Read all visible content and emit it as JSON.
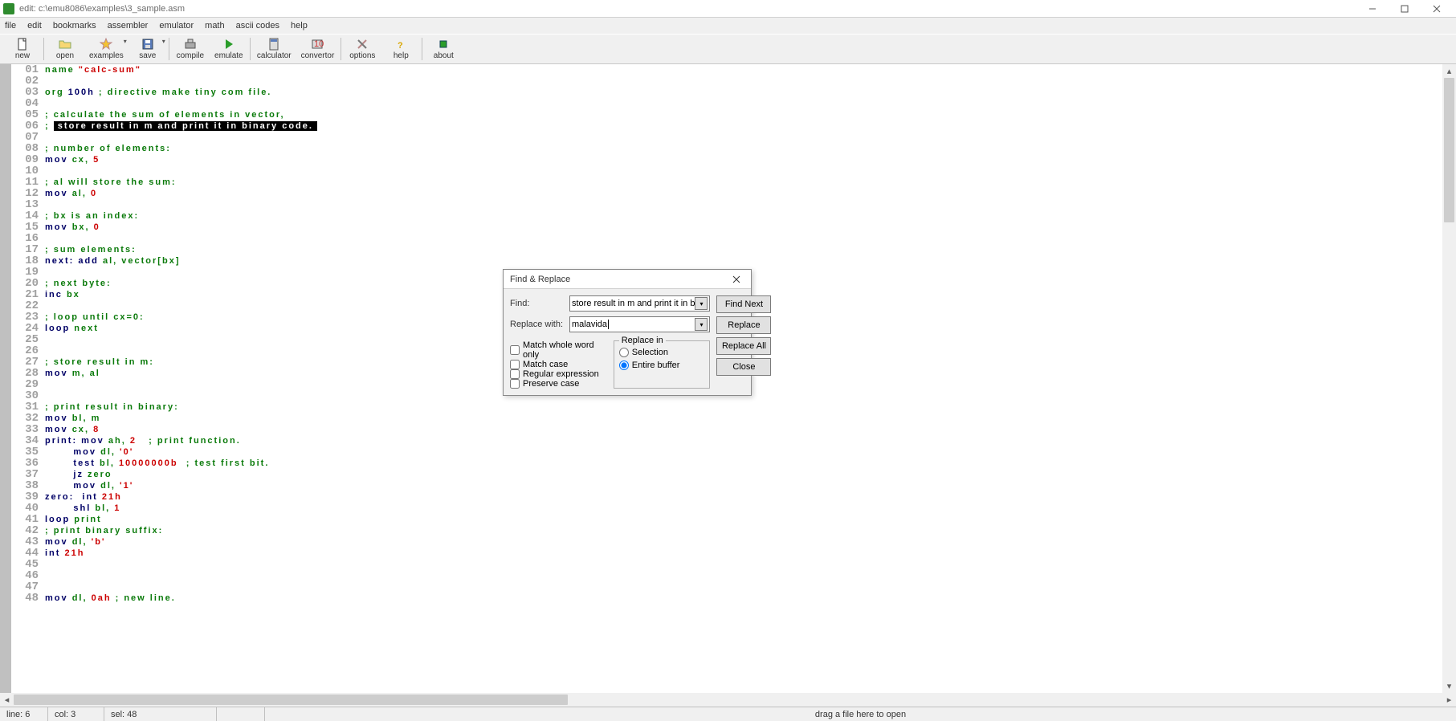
{
  "window": {
    "title": "edit: c:\\emu8086\\examples\\3_sample.asm"
  },
  "menu": {
    "items": [
      "file",
      "edit",
      "bookmarks",
      "assembler",
      "emulator",
      "math",
      "ascii codes",
      "help"
    ]
  },
  "toolbar": {
    "items": [
      {
        "id": "new",
        "label": "new"
      },
      {
        "id": "open",
        "label": "open"
      },
      {
        "id": "examples",
        "label": "examples",
        "dropdown": true
      },
      {
        "id": "save",
        "label": "save",
        "dropdown": true
      },
      {
        "id": "compile",
        "label": "compile"
      },
      {
        "id": "emulate",
        "label": "emulate"
      },
      {
        "id": "calculator",
        "label": "calculator"
      },
      {
        "id": "convertor",
        "label": "convertor"
      },
      {
        "id": "options",
        "label": "options"
      },
      {
        "id": "help",
        "label": "help"
      },
      {
        "id": "about",
        "label": "about"
      }
    ]
  },
  "editor": {
    "first_line": 1,
    "visible_lines": 48,
    "lines": [
      [
        [
          "t-dir",
          "name "
        ],
        [
          "t-str",
          "\"calc-sum\""
        ]
      ],
      [],
      [
        [
          "t-dir",
          "org "
        ],
        [
          "t-kw",
          "100h"
        ],
        [
          "t-cmt",
          " ; directive make tiny com file."
        ]
      ],
      [],
      [
        [
          "t-cmt",
          "; calculate the sum of elements in vector,"
        ]
      ],
      [
        [
          "t-cmt",
          "; "
        ],
        [
          "t-sel",
          " store result in m and print it in binary code. "
        ]
      ],
      [],
      [
        [
          "t-cmt",
          "; number of elements:"
        ]
      ],
      [
        [
          "t-kw",
          "mov "
        ],
        [
          "t-reg",
          "cx"
        ],
        [
          "t-op",
          ", "
        ],
        [
          "t-num",
          "5"
        ]
      ],
      [],
      [
        [
          "t-cmt",
          "; al will store the sum:"
        ]
      ],
      [
        [
          "t-kw",
          "mov "
        ],
        [
          "t-reg",
          "al"
        ],
        [
          "t-op",
          ", "
        ],
        [
          "t-num",
          "0"
        ]
      ],
      [],
      [
        [
          "t-cmt",
          "; bx is an index:"
        ]
      ],
      [
        [
          "t-kw",
          "mov "
        ],
        [
          "t-reg",
          "bx"
        ],
        [
          "t-op",
          ", "
        ],
        [
          "t-num",
          "0"
        ]
      ],
      [],
      [
        [
          "t-cmt",
          "; sum elements:"
        ]
      ],
      [
        [
          "t-lbl",
          "next:"
        ],
        [
          "t-kw",
          " add "
        ],
        [
          "t-reg",
          "al"
        ],
        [
          "t-op",
          ", "
        ],
        [
          "t-id",
          "vector"
        ],
        [
          "t-op",
          "["
        ],
        [
          "t-reg",
          "bx"
        ],
        [
          "t-op",
          "]"
        ]
      ],
      [],
      [
        [
          "t-cmt",
          "; next byte:"
        ]
      ],
      [
        [
          "t-kw",
          "inc "
        ],
        [
          "t-reg",
          "bx"
        ]
      ],
      [],
      [
        [
          "t-cmt",
          "; loop until cx=0:"
        ]
      ],
      [
        [
          "t-kw",
          "loop "
        ],
        [
          "t-id",
          "next"
        ]
      ],
      [],
      [],
      [
        [
          "t-cmt",
          "; store result in m:"
        ]
      ],
      [
        [
          "t-kw",
          "mov "
        ],
        [
          "t-id",
          "m"
        ],
        [
          "t-op",
          ", "
        ],
        [
          "t-reg",
          "al"
        ]
      ],
      [],
      [],
      [
        [
          "t-cmt",
          "; print result in binary:"
        ]
      ],
      [
        [
          "t-kw",
          "mov "
        ],
        [
          "t-reg",
          "bl"
        ],
        [
          "t-op",
          ", "
        ],
        [
          "t-id",
          "m"
        ]
      ],
      [
        [
          "t-kw",
          "mov "
        ],
        [
          "t-reg",
          "cx"
        ],
        [
          "t-op",
          ", "
        ],
        [
          "t-num",
          "8"
        ]
      ],
      [
        [
          "t-lbl",
          "print:"
        ],
        [
          "t-kw",
          " mov "
        ],
        [
          "t-reg",
          "ah"
        ],
        [
          "t-op",
          ", "
        ],
        [
          "t-num",
          "2"
        ],
        [
          "t-cmt",
          "   ; print function."
        ]
      ],
      [
        [
          "",
          "       "
        ],
        [
          "t-kw",
          "mov "
        ],
        [
          "t-reg",
          "dl"
        ],
        [
          "t-op",
          ", "
        ],
        [
          "t-str",
          "'0'"
        ]
      ],
      [
        [
          "",
          "       "
        ],
        [
          "t-kw",
          "test "
        ],
        [
          "t-reg",
          "bl"
        ],
        [
          "t-op",
          ", "
        ],
        [
          "t-num",
          "10000000b"
        ],
        [
          "t-cmt",
          "  ; test first bit."
        ]
      ],
      [
        [
          "",
          "       "
        ],
        [
          "t-kw",
          "jz "
        ],
        [
          "t-id",
          "zero"
        ]
      ],
      [
        [
          "",
          "       "
        ],
        [
          "t-kw",
          "mov "
        ],
        [
          "t-reg",
          "dl"
        ],
        [
          "t-op",
          ", "
        ],
        [
          "t-str",
          "'1'"
        ]
      ],
      [
        [
          "t-lbl",
          "zero:"
        ],
        [
          "",
          "  "
        ],
        [
          "t-kw",
          "int "
        ],
        [
          "t-num",
          "21h"
        ]
      ],
      [
        [
          "",
          "       "
        ],
        [
          "t-kw",
          "shl "
        ],
        [
          "t-reg",
          "bl"
        ],
        [
          "t-op",
          ", "
        ],
        [
          "t-num",
          "1"
        ]
      ],
      [
        [
          "t-kw",
          "loop "
        ],
        [
          "t-id",
          "print"
        ]
      ],
      [
        [
          "t-cmt",
          "; print binary suffix:"
        ]
      ],
      [
        [
          "t-kw",
          "mov "
        ],
        [
          "t-reg",
          "dl"
        ],
        [
          "t-op",
          ", "
        ],
        [
          "t-str",
          "'b'"
        ]
      ],
      [
        [
          "t-kw",
          "int "
        ],
        [
          "t-num",
          "21h"
        ]
      ],
      [],
      [],
      [],
      [
        [
          "t-kw",
          "mov "
        ],
        [
          "t-reg",
          "dl"
        ],
        [
          "t-op",
          ", "
        ],
        [
          "t-num",
          "0ah"
        ],
        [
          "t-cmt",
          " ; new line."
        ]
      ]
    ]
  },
  "status": {
    "line": "line: 6",
    "col": "col: 3",
    "sel": "sel: 48",
    "hint": "drag a file here to open"
  },
  "dialog": {
    "title": "Find & Replace",
    "find_label": "Find:",
    "replace_label": "Replace with:",
    "find_value": "store result in m and print it in b",
    "replace_value": "malavida",
    "match_word": "Match whole word only",
    "match_case": "Match case",
    "regex": "Regular expression",
    "preserve": "Preserve case",
    "replace_in": "Replace in",
    "selection": "Selection",
    "entire": "Entire buffer",
    "find_next": "Find Next",
    "replace": "Replace",
    "replace_all": "Replace All",
    "close": "Close"
  }
}
